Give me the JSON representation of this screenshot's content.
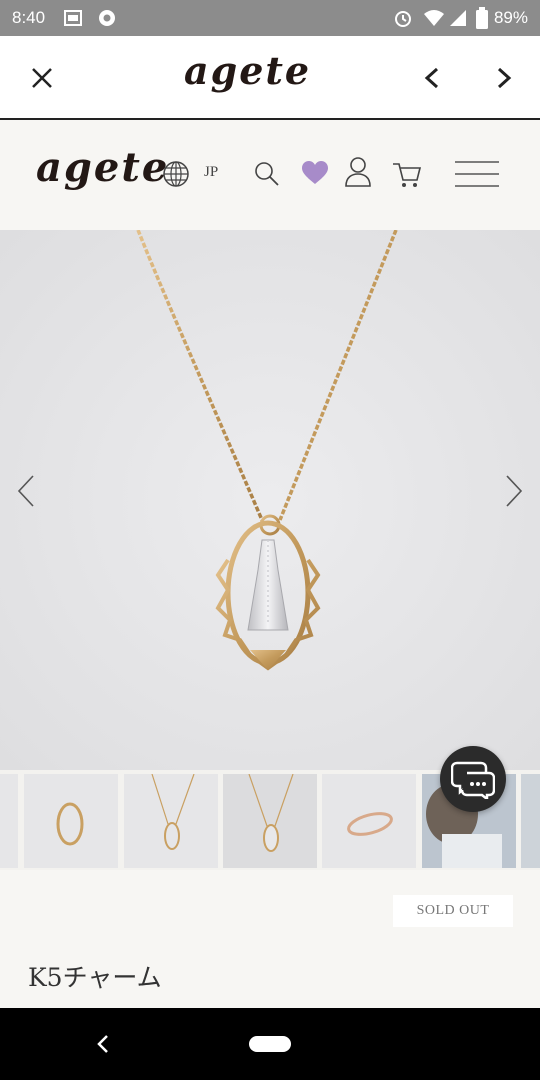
{
  "status_bar": {
    "time": "8:40",
    "battery": "89%",
    "icons": [
      "hd-icon",
      "chrome-icon",
      "alarm-icon",
      "wifi-icon",
      "signal-icon",
      "battery-icon"
    ]
  },
  "browser": {
    "title_logo": "agete",
    "icons": [
      "close-icon",
      "back-arrow-icon",
      "forward-arrow-icon"
    ]
  },
  "site_header": {
    "logo": "agete",
    "language": "JP",
    "icons": [
      "globe-icon",
      "search-icon",
      "heart-icon",
      "account-icon",
      "cart-icon",
      "menu-icon"
    ],
    "heart_color": "#a78bc9"
  },
  "gallery": {
    "icons": [
      "chevron-left-icon",
      "chevron-right-icon"
    ]
  },
  "product": {
    "status_badge": "SOLD OUT",
    "name": "K5チャーム"
  },
  "chat": {
    "icon": "chat-icon"
  },
  "colors": {
    "gold": "#c9a062",
    "silver": "#d9d9dc",
    "background": "#f7f6f3"
  }
}
